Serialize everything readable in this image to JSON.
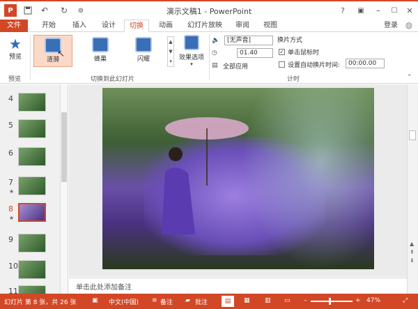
{
  "app": {
    "title": "演示文稿1 - PowerPoint",
    "help": "?",
    "sign_in": "登录"
  },
  "tabs": [
    "文件",
    "开始",
    "插入",
    "设计",
    "切换",
    "动画",
    "幻灯片放映",
    "审阅",
    "视图"
  ],
  "ribbon": {
    "preview_label": "预览",
    "preview_group": "预览",
    "transitions": [
      {
        "label": "涟漪"
      },
      {
        "label": "蜂巢"
      },
      {
        "label": "闪耀"
      }
    ],
    "effect_options": "效果选项",
    "transition_group": "切换到此幻灯片",
    "sound_value": "[无声音]",
    "duration_value": "01.40",
    "apply_all": "全部应用",
    "advance_title": "换片方式",
    "on_click": "单击鼠标时",
    "after": "设置自动换片时间:",
    "after_value": "00:00.00",
    "timing_group": "计时"
  },
  "slides": [
    {
      "num": "4",
      "star": ""
    },
    {
      "num": "5",
      "star": ""
    },
    {
      "num": "6",
      "star": ""
    },
    {
      "num": "7",
      "star": "★"
    },
    {
      "num": "8",
      "star": "★"
    },
    {
      "num": "9",
      "star": ""
    },
    {
      "num": "10",
      "star": ""
    },
    {
      "num": "11",
      "star": ""
    }
  ],
  "notes_placeholder": "单击此处添加备注",
  "status": {
    "slide_info": "幻灯片 第 8 张，共 26 张",
    "language": "中文(中国)",
    "notes": "备注",
    "comments": "批注",
    "zoom": "47%"
  },
  "colors": {
    "accent": "#d24726"
  }
}
